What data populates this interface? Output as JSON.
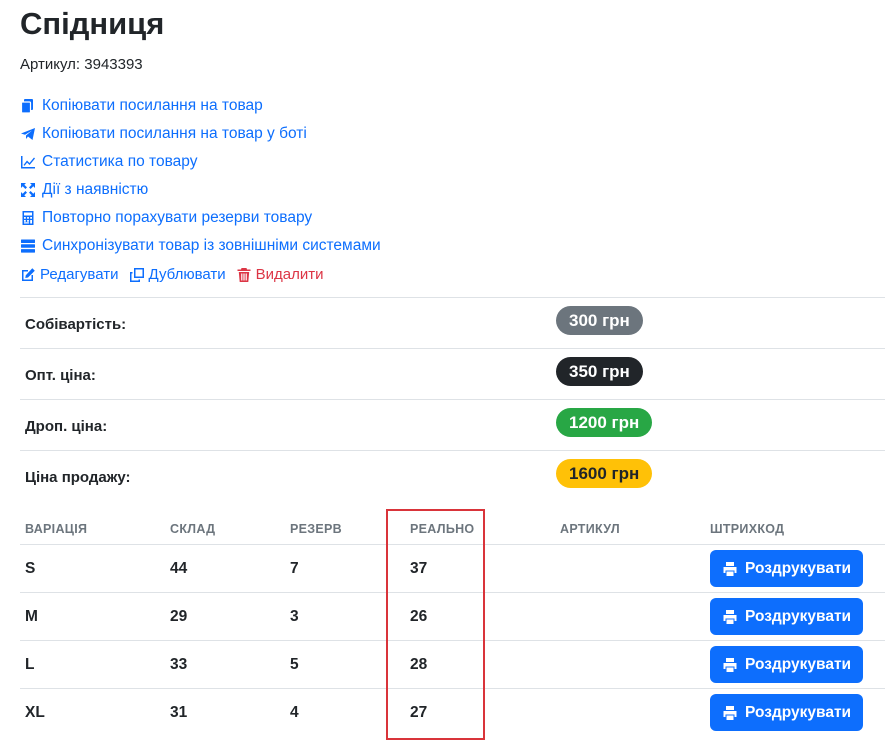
{
  "product": {
    "title": "Спідниця",
    "sku_label": "Артикул: 3943393"
  },
  "actions": [
    {
      "label": "Копіювати посилання на товар",
      "icon": "copy-icon"
    },
    {
      "label": "Копіювати посилання на товар у боті",
      "icon": "telegram-icon"
    },
    {
      "label": "Статистика по товару",
      "icon": "chart-line-icon"
    },
    {
      "label": "Дії з наявністю",
      "icon": "expand-arrows-icon"
    },
    {
      "label": "Повторно порахувати резерви товару",
      "icon": "calculator-icon"
    },
    {
      "label": "Синхронізувати товар із зовнішніми системами",
      "icon": "server-icon"
    }
  ],
  "edit_actions": {
    "edit": "Редагувати",
    "duplicate": "Дублювати",
    "delete": "Видалити"
  },
  "prices": [
    {
      "label": "Собівартість:",
      "value": "300 грн",
      "color": "#6c757d"
    },
    {
      "label": "Опт. ціна:",
      "value": "350 грн",
      "color": "#212529"
    },
    {
      "label": "Дроп. ціна:",
      "value": "1200 грн",
      "color": "#28a745"
    },
    {
      "label": "Ціна продажу:",
      "value": "1600 грн",
      "color": "#ffc107"
    }
  ],
  "stock_table": {
    "headers": [
      "ВАРІАЦІЯ",
      "СКЛАД",
      "РЕЗЕРВ",
      "РЕАЛЬНО",
      "АРТИКУЛ",
      "ШТРИХКОД"
    ],
    "print_label": "Роздрукувати",
    "rows": [
      {
        "variation": "S",
        "stock": "44",
        "reserve": "7",
        "real": "37",
        "sku": ""
      },
      {
        "variation": "M",
        "stock": "29",
        "reserve": "3",
        "real": "26",
        "sku": ""
      },
      {
        "variation": "L",
        "stock": "33",
        "reserve": "5",
        "real": "28",
        "sku": ""
      },
      {
        "variation": "XL",
        "stock": "31",
        "reserve": "4",
        "real": "27",
        "sku": ""
      }
    ]
  },
  "colors": {
    "link": "#0d6efd",
    "danger": "#dc3545",
    "highlight": "#d9343a"
  }
}
